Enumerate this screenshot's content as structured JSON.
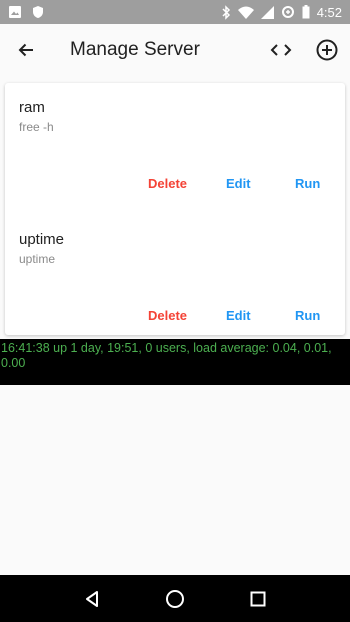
{
  "status_bar": {
    "time": "4:52",
    "icons": [
      "image-icon",
      "shield-icon",
      "bluetooth-icon",
      "wifi-icon",
      "signal-icon",
      "data-saver-icon",
      "battery-icon"
    ]
  },
  "app_bar": {
    "title": "Manage Server",
    "icons": [
      "arrow-back-icon",
      "code-icon",
      "add-circle-icon"
    ]
  },
  "commands": [
    {
      "name": "ram",
      "command": "free -h",
      "delete_label": "Delete",
      "edit_label": "Edit",
      "run_label": "Run"
    },
    {
      "name": "uptime",
      "command": "uptime",
      "delete_label": "Delete",
      "edit_label": "Edit",
      "run_label": "Run"
    }
  ],
  "terminal": {
    "output": "16:41:38 up 1 day, 19:51,  0 users,  load average: 0.04, 0.01, 0.00"
  },
  "nav_bar": {
    "icons": [
      "back-triangle-icon",
      "home-circle-icon",
      "recents-square-icon"
    ]
  },
  "colors": {
    "delete": "#f44336",
    "accent": "#2196f3",
    "terminal_text": "#4caf50",
    "status_bar": "#9e9e9e"
  }
}
